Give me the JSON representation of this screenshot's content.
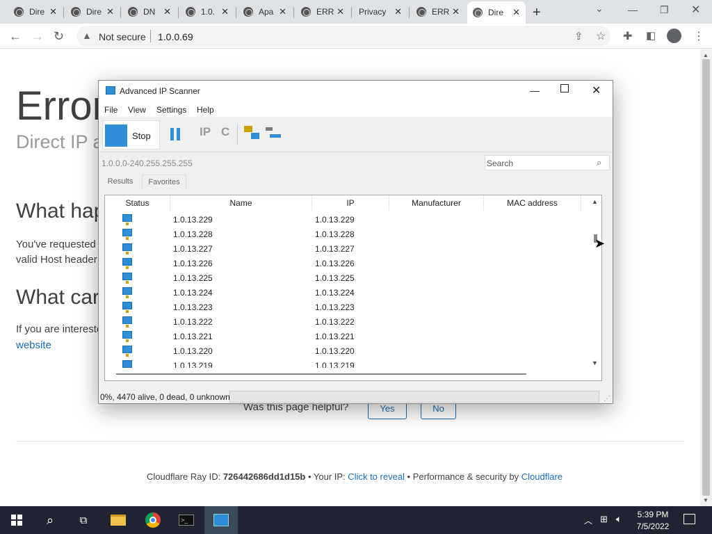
{
  "browser": {
    "tabs": [
      {
        "label": "Dire"
      },
      {
        "label": "Dire"
      },
      {
        "label": "DN"
      },
      {
        "label": "1.0."
      },
      {
        "label": "Apa"
      },
      {
        "label": "ERR"
      },
      {
        "label": "Privacy"
      },
      {
        "label": "ERR"
      },
      {
        "label": "Dire"
      }
    ],
    "new_tab_label": "+",
    "security_label": "Not secure",
    "url": "1.0.0.69"
  },
  "webpage": {
    "heading": "Error",
    "subheading": "Direct IP a",
    "section1_heading": "What hap",
    "section1_text_line1": "You've requested",
    "section1_text_line2": "valid Host header",
    "section2_heading": "What car",
    "section2_text": "If you are intereste",
    "section2_link": "website",
    "helpful_question": "Was this page helpful?",
    "yes_label": "Yes",
    "no_label": "No",
    "footer_ray_prefix": "Cloudflare Ray ID: ",
    "footer_ray_id": "726442686dd1d15b",
    "footer_ip_prefix": " • Your IP: ",
    "footer_reveal": "Click to reveal",
    "footer_perf": " • Performance & security by ",
    "footer_cloudflare": "Cloudflare"
  },
  "scanner": {
    "title": "Advanced IP Scanner",
    "menu": [
      "File",
      "View",
      "Settings",
      "Help"
    ],
    "stop_label": "Stop",
    "range": "1.0.0.0-240.255.255.255",
    "search_placeholder": "Search",
    "tabs": [
      "Results",
      "Favorites"
    ],
    "columns": [
      "Status",
      "Name",
      "IP",
      "Manufacturer",
      "MAC address"
    ],
    "rows": [
      {
        "name": "1.0.13.229",
        "ip": "1.0.13.229"
      },
      {
        "name": "1.0.13.228",
        "ip": "1.0.13.228"
      },
      {
        "name": "1.0.13.227",
        "ip": "1.0.13.227"
      },
      {
        "name": "1.0.13.226",
        "ip": "1.0.13.226"
      },
      {
        "name": "1.0.13.225",
        "ip": "1.0.13.225"
      },
      {
        "name": "1.0.13.224",
        "ip": "1.0.13.224"
      },
      {
        "name": "1.0.13.223",
        "ip": "1.0.13.223"
      },
      {
        "name": "1.0.13.222",
        "ip": "1.0.13.222"
      },
      {
        "name": "1.0.13.221",
        "ip": "1.0.13.221"
      },
      {
        "name": "1.0.13.220",
        "ip": "1.0.13.220"
      },
      {
        "name": "1.0.13.219",
        "ip": "1.0.13.219"
      }
    ],
    "status": "0%, 4470 alive, 0 dead, 0 unknown"
  },
  "taskbar": {
    "time": "5:39 PM",
    "date": "7/5/2022"
  },
  "colors": {
    "accent": "#2f8ed6",
    "link": "#1a6fb3",
    "taskbar": "#1f2430"
  }
}
